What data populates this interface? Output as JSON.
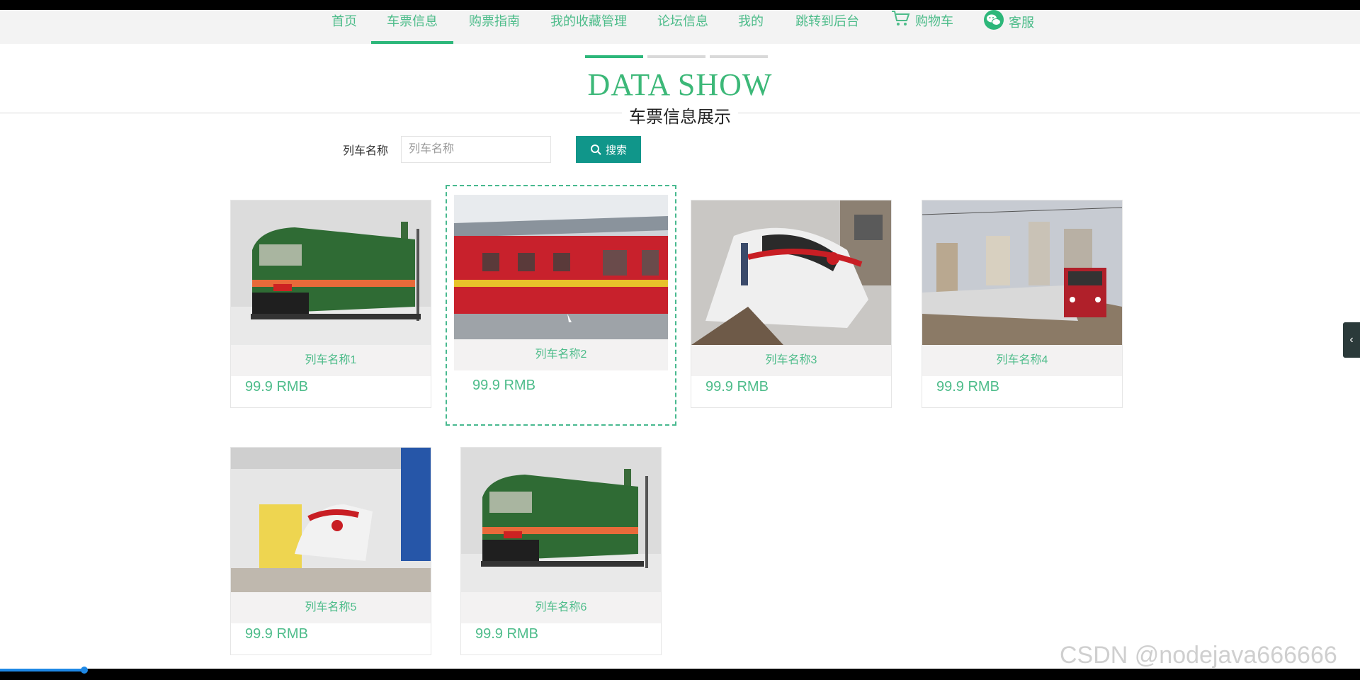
{
  "nav": {
    "items": [
      {
        "label": "首页"
      },
      {
        "label": "车票信息"
      },
      {
        "label": "购票指南"
      },
      {
        "label": "我的收藏管理"
      },
      {
        "label": "论坛信息"
      },
      {
        "label": "我的"
      },
      {
        "label": "跳转到后台"
      },
      {
        "label": "购物车",
        "icon": "cart-icon"
      },
      {
        "label": "客服",
        "icon": "wechat-icon"
      }
    ],
    "active": "车票信息"
  },
  "hero": {
    "title": "DATA SHOW",
    "subtitle": "车票信息展示"
  },
  "search": {
    "label": "列车名称",
    "placeholder": "列车名称",
    "button_label": "搜索"
  },
  "cards": [
    {
      "name": "列车名称1",
      "price": "99.9 RMB"
    },
    {
      "name": "列车名称2",
      "price": "99.9 RMB"
    },
    {
      "name": "列车名称3",
      "price": "99.9 RMB"
    },
    {
      "name": "列车名称4",
      "price": "99.9 RMB"
    },
    {
      "name": "列车名称5",
      "price": "99.9 RMB"
    },
    {
      "name": "列车名称6",
      "price": "99.9 RMB"
    }
  ],
  "side_handle": "‹",
  "watermark": "CSDN @nodejava666666",
  "colors": {
    "accent": "#4dbc8a",
    "button": "#10968a",
    "nav_bg": "#f3f3f3"
  }
}
